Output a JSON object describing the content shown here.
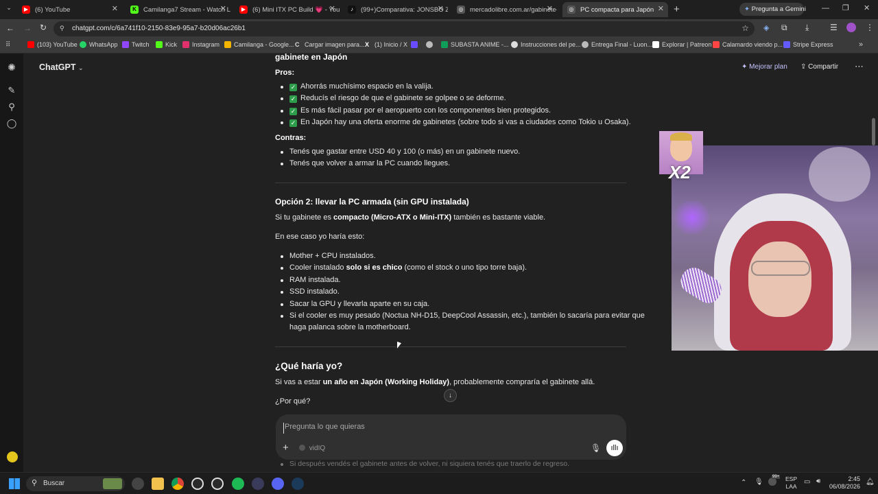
{
  "tabs": [
    {
      "title": "(6) YouTube",
      "color": "#ff0000"
    },
    {
      "title": "Camilanga7 Stream - Watch Liv",
      "color": "#53fc18"
    },
    {
      "title": "(6) Mini ITX PC Build 💗 - YouT",
      "color": "#ff0000"
    },
    {
      "title": "(99+)Comparativa: JONSBO Z2",
      "color": "#111111"
    },
    {
      "title": "mercadolibre.com.ar/gabinete-",
      "color": "#7a7a7a"
    },
    {
      "title": "PC compacta para Japón",
      "color": "#7a7a7a"
    }
  ],
  "gemini_button": "Pregunta a Gemini",
  "url": "chatgpt.com/c/6a741f10-2150-83e9-95a7-b20d06ac26b1",
  "bookmarks": [
    {
      "label": "(103) YouTube",
      "color": "#ff0000"
    },
    {
      "label": "WhatsApp",
      "color": "#25d366"
    },
    {
      "label": "Twitch",
      "color": "#9146ff"
    },
    {
      "label": "Kick",
      "color": "#53fc18"
    },
    {
      "label": "Instagram",
      "color": "#e1306c"
    },
    {
      "label": "Camilanga - Google...",
      "color": "#f4b400"
    },
    {
      "label": "Cargar imagen para...",
      "color": "#dddddd"
    },
    {
      "label": "(1) Inicio / X",
      "color": "#000000"
    },
    {
      "label": "",
      "color": "#6a4cff"
    },
    {
      "label": "",
      "color": "#bbbbbb"
    },
    {
      "label": "SUBASTA ANIME -...",
      "color": "#0f9d58"
    },
    {
      "label": "Instrucciones del pe...",
      "color": "#dddddd"
    },
    {
      "label": "Entrega Final - Luon...",
      "color": "#bbbbbb"
    },
    {
      "label": "Explorar | Patreon",
      "color": "#ffffff"
    },
    {
      "label": "Calamardo viendo p...",
      "color": "#ff4444"
    },
    {
      "label": "Stripe Express",
      "color": "#635bff"
    }
  ],
  "app": {
    "name": "ChatGPT",
    "upgrade": "Mejorar plan",
    "share": "Compartir"
  },
  "chat": {
    "heading_cut": "gabinete en Japón",
    "pros_label": "Pros:",
    "pros": [
      "Ahorrás muchísimo espacio en la valija.",
      "Reducís el riesgo de que el gabinete se golpee o se deforme.",
      "Es más fácil pasar por el aeropuerto con los componentes bien protegidos.",
      "En Japón hay una oferta enorme de gabinetes (sobre todo si vas a ciudades como Tokio u Osaka)."
    ],
    "cons_label": "Contras:",
    "cons": [
      "Tenés que gastar entre USD 40 y 100 (o más) en un gabinete nuevo.",
      "Tenés que volver a armar la PC cuando llegues."
    ],
    "option2_title": "Opción 2: llevar la PC armada (sin GPU instalada)",
    "option2_intro_a": "Si tu gabinete es ",
    "option2_intro_b": "compacto (Micro-ATX o Mini-ITX)",
    "option2_intro_c": " también es bastante viable.",
    "case_line": "En ese caso yo haría esto:",
    "steps": [
      "Mother + CPU instalados.",
      "RAM instalada.",
      "SSD instalado.",
      "Sacar la GPU y llevarla aparte en su caja."
    ],
    "cooler_a": "Cooler instalado ",
    "cooler_b": "solo si es chico",
    "cooler_c": " (como el stock o uno tipo torre baja).",
    "heavy_line1": "Si el cooler es muy pesado (Noctua NH-D15, DeepCool Assassin, etc.), también lo sacaría para evitar que",
    "heavy_line2": "haga palanca sobre la motherboard.",
    "what_title": "¿Qué haría yo?",
    "what_a": "Si vas a estar ",
    "what_b": "un año en Japón (Working Holiday)",
    "what_c": ", probablemente compraría el gabinete allá.",
    "why": "¿Por qué?",
    "behind_text": "Si después vendés el gabinete antes de volver, ni siquiera tenés que traerlo de regreso."
  },
  "composer": {
    "placeholder": "Pregunta lo que quieras",
    "tool": "vidIQ"
  },
  "overlay": {
    "badge": "X2"
  },
  "taskbar": {
    "search": "Buscar",
    "lang1": "ESP",
    "lang2": "LAA",
    "time": "2:45",
    "date": "06/08/2026",
    "notif": "99+"
  }
}
